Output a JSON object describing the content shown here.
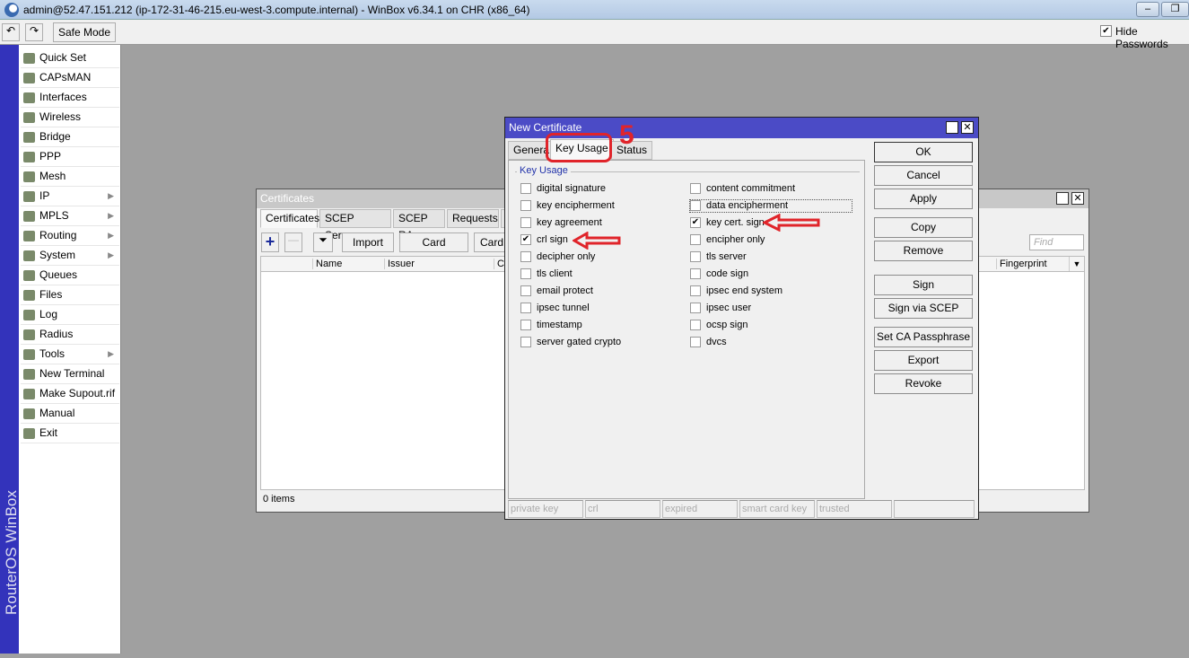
{
  "window": {
    "title": "admin@52.47.151.212 (ip-172-31-46-215.eu-west-3.compute.internal) - WinBox v6.34.1 on CHR (x86_64)"
  },
  "toolbar": {
    "undo": "↶",
    "redo": "↷",
    "safe_mode": "Safe Mode",
    "hide_passwords": "Hide Passwords",
    "hide_passwords_checked": true
  },
  "brand": "RouterOS WinBox",
  "sidebar": {
    "items": [
      {
        "label": "Quick Set",
        "sub": false
      },
      {
        "label": "CAPsMAN",
        "sub": false
      },
      {
        "label": "Interfaces",
        "sub": false
      },
      {
        "label": "Wireless",
        "sub": false
      },
      {
        "label": "Bridge",
        "sub": false
      },
      {
        "label": "PPP",
        "sub": false
      },
      {
        "label": "Mesh",
        "sub": false
      },
      {
        "label": "IP",
        "sub": true
      },
      {
        "label": "MPLS",
        "sub": true
      },
      {
        "label": "Routing",
        "sub": true
      },
      {
        "label": "System",
        "sub": true
      },
      {
        "label": "Queues",
        "sub": false
      },
      {
        "label": "Files",
        "sub": false
      },
      {
        "label": "Log",
        "sub": false
      },
      {
        "label": "Radius",
        "sub": false
      },
      {
        "label": "Tools",
        "sub": true
      },
      {
        "label": "New Terminal",
        "sub": false
      },
      {
        "label": "Make Supout.rif",
        "sub": false
      },
      {
        "label": "Manual",
        "sub": false
      },
      {
        "label": "Exit",
        "sub": false
      }
    ]
  },
  "certificates": {
    "title": "Certificates",
    "tabs": [
      "Certificates",
      "SCEP Servers",
      "SCEP RA",
      "Requests",
      "O"
    ],
    "buttons": {
      "import": "Import",
      "card_reinstall": "Card Reinstall",
      "card": "Card"
    },
    "columns": [
      "Name",
      "Issuer",
      "Co",
      "Fingerprint"
    ],
    "find_placeholder": "Find",
    "status": "0 items"
  },
  "dialog": {
    "title": "New Certificate",
    "tabs": [
      "Genera",
      "Key Usage",
      "Status"
    ],
    "group": "Key Usage",
    "left": [
      {
        "label": "digital signature",
        "checked": false
      },
      {
        "label": "key encipherment",
        "checked": false
      },
      {
        "label": "key agreement",
        "checked": false
      },
      {
        "label": "crl sign",
        "checked": true
      },
      {
        "label": "decipher only",
        "checked": false
      },
      {
        "label": "tls client",
        "checked": false
      },
      {
        "label": "email protect",
        "checked": false
      },
      {
        "label": "ipsec tunnel",
        "checked": false
      },
      {
        "label": "timestamp",
        "checked": false
      },
      {
        "label": "server gated crypto",
        "checked": false
      }
    ],
    "right": [
      {
        "label": "content commitment",
        "checked": false
      },
      {
        "label": "data encipherment",
        "checked": false
      },
      {
        "label": "key cert. sign",
        "checked": true
      },
      {
        "label": "encipher only",
        "checked": false
      },
      {
        "label": "tls server",
        "checked": false
      },
      {
        "label": "code sign",
        "checked": false
      },
      {
        "label": "ipsec end system",
        "checked": false
      },
      {
        "label": "ipsec user",
        "checked": false
      },
      {
        "label": "ocsp sign",
        "checked": false
      },
      {
        "label": "dvcs",
        "checked": false
      }
    ],
    "buttons": [
      "OK",
      "Cancel",
      "Apply",
      "Copy",
      "Remove",
      "Sign",
      "Sign via SCEP",
      "Set CA Passphrase",
      "Export",
      "Revoke"
    ],
    "status_fields": [
      "private key",
      "crl",
      "expired",
      "smart card key",
      "trusted",
      ""
    ]
  },
  "annotation": {
    "step": "5",
    "color": "#e0242a"
  }
}
